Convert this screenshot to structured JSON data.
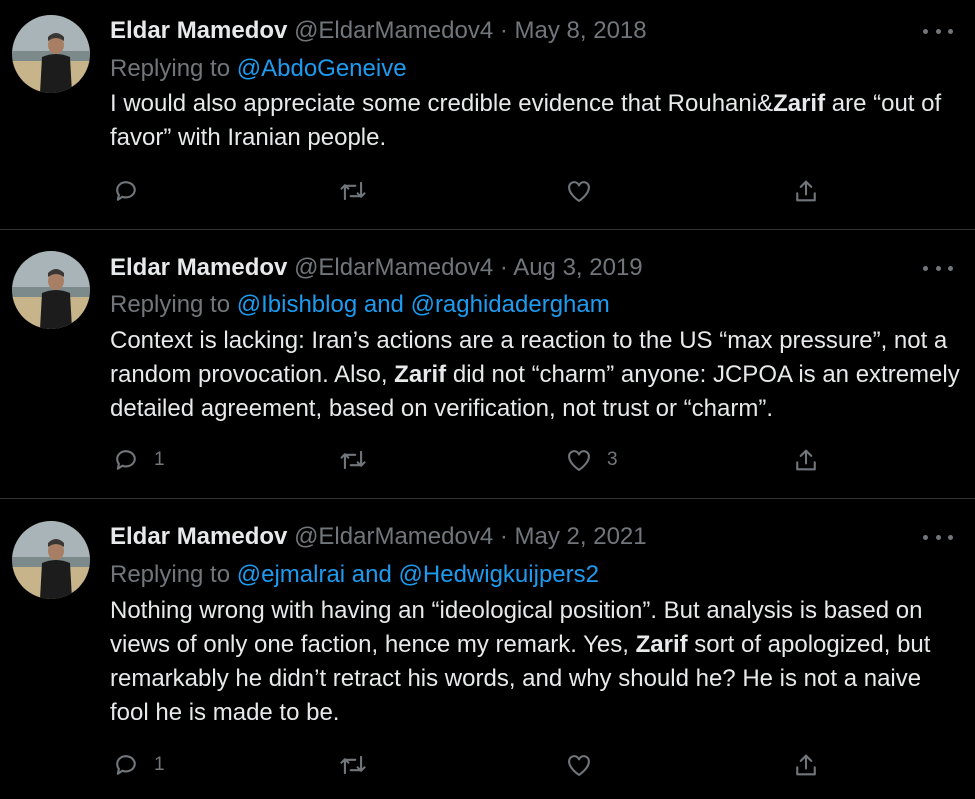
{
  "colors": {
    "background": "#000000",
    "text": "#e7e9ea",
    "muted": "#71767b",
    "link": "#1d9bf0",
    "divider": "#2f3336"
  },
  "tweets": [
    {
      "author": "Eldar Mamedov",
      "handle": "@EldarMamedov4",
      "separator": "·",
      "date": "May 8, 2018",
      "replying_to_label": "Replying to",
      "replying_to_1": "@AbdoGeneive",
      "replying_and": "",
      "replying_to_2": "",
      "text_parts": [
        "I would also appreciate some credible evidence that Rouhani&",
        "Zarif",
        " are “out of favor” with Iranian people."
      ],
      "reply_count": "",
      "retweet_count": "",
      "like_count": "",
      "icons": [
        "reply-icon",
        "retweet-icon",
        "like-icon",
        "share-icon",
        "more-icon"
      ]
    },
    {
      "author": "Eldar Mamedov",
      "handle": "@EldarMamedov4",
      "separator": "·",
      "date": "Aug 3, 2019",
      "replying_to_label": "Replying to",
      "replying_to_1": "@Ibishblog",
      "replying_and": " and ",
      "replying_to_2": "@raghidadergham",
      "text_parts": [
        "Context is lacking: Iran’s actions are a reaction to the US “max pressure”, not a random provocation. Also, ",
        "Zarif",
        " did not “charm” anyone: JCPOA is an extremely detailed agreement, based on verification, not trust or “charm”."
      ],
      "reply_count": "1",
      "retweet_count": "",
      "like_count": "3",
      "icons": [
        "reply-icon",
        "retweet-icon",
        "like-icon",
        "share-icon",
        "more-icon"
      ]
    },
    {
      "author": "Eldar Mamedov",
      "handle": "@EldarMamedov4",
      "separator": "·",
      "date": "May 2, 2021",
      "replying_to_label": "Replying to",
      "replying_to_1": "@ejmalrai",
      "replying_and": " and ",
      "replying_to_2": "@Hedwigkuijpers2",
      "text_parts": [
        "Nothing wrong with having an “ideological position”. But analysis is based on views of only one faction, hence my remark. Yes, ",
        "Zarif",
        " sort of apologized, but remarkably he didn’t retract his words, and why should he? He is not a naive fool he is made to be."
      ],
      "reply_count": "1",
      "retweet_count": "",
      "like_count": "",
      "icons": [
        "reply-icon",
        "retweet-icon",
        "like-icon",
        "share-icon",
        "more-icon"
      ]
    }
  ]
}
